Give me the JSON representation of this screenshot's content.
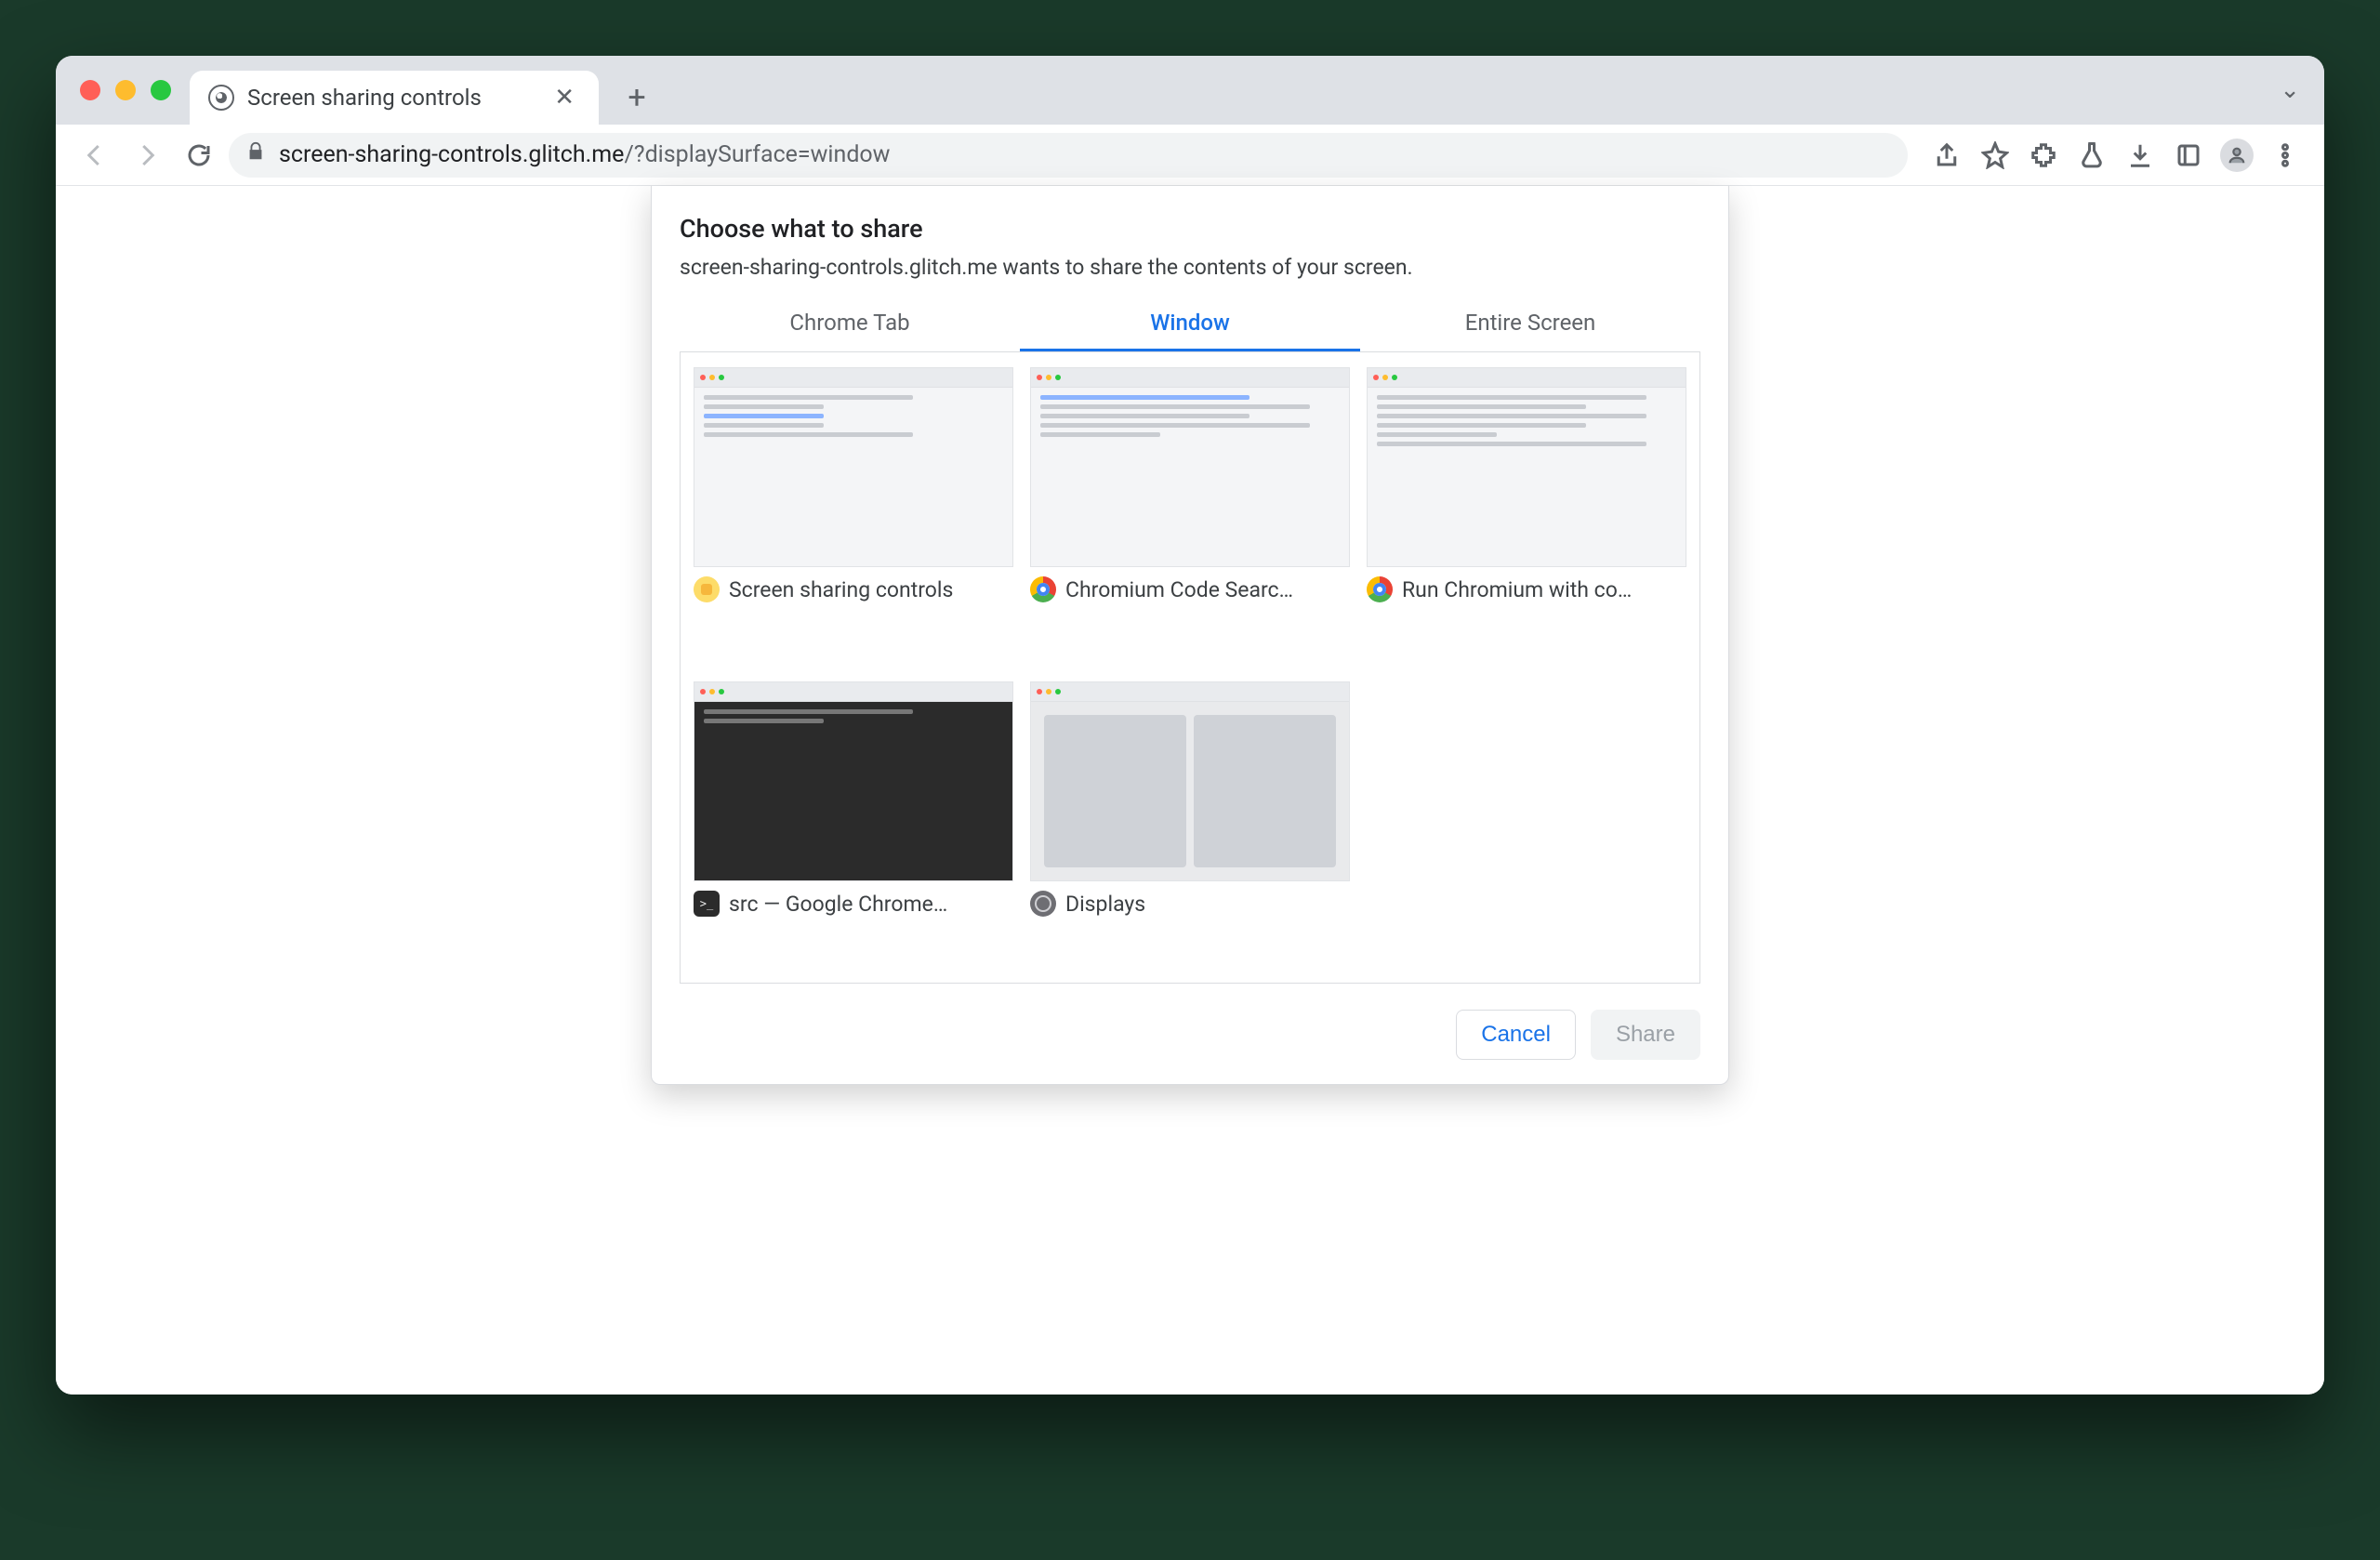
{
  "browser": {
    "tab_title": "Screen sharing controls",
    "url_host": "screen-sharing-controls.glitch.me",
    "url_path": "/?displaySurface=window"
  },
  "modal": {
    "title": "Choose what to share",
    "subtitle": "screen-sharing-controls.glitch.me wants to share the contents of your screen.",
    "tabs": {
      "chrome_tab": "Chrome Tab",
      "window": "Window",
      "entire_screen": "Entire Screen"
    },
    "active_tab": "window",
    "windows": [
      {
        "label": "Screen sharing controls",
        "icon": "glitch"
      },
      {
        "label": "Chromium Code Searc…",
        "icon": "chrome"
      },
      {
        "label": "Run Chromium with co…",
        "icon": "chrome"
      },
      {
        "label": "src — Google Chrome…",
        "icon": "term"
      },
      {
        "label": "Displays",
        "icon": "sys"
      }
    ],
    "buttons": {
      "cancel": "Cancel",
      "share": "Share"
    }
  }
}
